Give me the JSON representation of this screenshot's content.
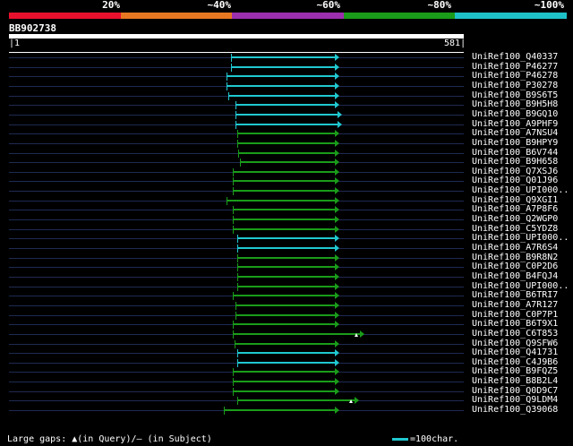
{
  "scale": {
    "segments": [
      {
        "label": "20%",
        "color": "#e8112d"
      },
      {
        "label": "~40%",
        "color": "#e87722"
      },
      {
        "label": "~60%",
        "color": "#9b2fae"
      },
      {
        "label": "~80%",
        "color": "#1a9c1a"
      },
      {
        "label": "~100%",
        "color": "#1ec1c8"
      }
    ]
  },
  "query": {
    "name": "BB902738",
    "start": "1",
    "end": "581"
  },
  "colors": {
    "cyan": "#20c8d0",
    "green": "#1a9c1a",
    "row": "#1f2a52"
  },
  "hits": [
    {
      "label": "UniRef100_Q40337",
      "color": "cyan",
      "gap": "none"
    },
    {
      "label": "UniRef100_P46277",
      "color": "cyan",
      "gap": "none"
    },
    {
      "label": "UniRef100_P46278",
      "color": "cyan",
      "gap": "none"
    },
    {
      "label": "UniRef100_P30278",
      "color": "cyan",
      "gap": "none"
    },
    {
      "label": "UniRef100_B9S6T5",
      "color": "cyan",
      "gap": "none"
    },
    {
      "label": "UniRef100_B9H5H8",
      "color": "cyan",
      "gap": "none"
    },
    {
      "label": "UniRef100_B9GQ10",
      "color": "cyan",
      "gap": "none"
    },
    {
      "label": "UniRef100_A9PHF9",
      "color": "cyan",
      "gap": "none"
    },
    {
      "label": "UniRef100_A7NSU4",
      "color": "green",
      "gap": "none"
    },
    {
      "label": "UniRef100_B9HPY9",
      "color": "green",
      "gap": "none"
    },
    {
      "label": "UniRef100_B6V744",
      "color": "green",
      "gap": "none"
    },
    {
      "label": "UniRef100_B9H658",
      "color": "green",
      "gap": "none"
    },
    {
      "label": "UniRef100_Q7XSJ6",
      "color": "green",
      "gap": "none"
    },
    {
      "label": "UniRef100_Q01J96",
      "color": "green",
      "gap": "none"
    },
    {
      "label": "UniRef100_UPI000..",
      "color": "green",
      "gap": "none"
    },
    {
      "label": "UniRef100_Q9XGI1",
      "color": "green",
      "gap": "none"
    },
    {
      "label": "UniRef100_A7P8F6",
      "color": "green",
      "gap": "none"
    },
    {
      "label": "UniRef100_Q2WGP0",
      "color": "green",
      "gap": "none"
    },
    {
      "label": "UniRef100_C5YDZ8",
      "color": "green",
      "gap": "none"
    },
    {
      "label": "UniRef100_UPI000..",
      "color": "cyan",
      "gap": "none"
    },
    {
      "label": "UniRef100_A7R6S4",
      "color": "cyan",
      "gap": "none"
    },
    {
      "label": "UniRef100_B9R8N2",
      "color": "green",
      "gap": "none"
    },
    {
      "label": "UniRef100_C0P2D6",
      "color": "green",
      "gap": "none"
    },
    {
      "label": "UniRef100_B4FQJ4",
      "color": "green",
      "gap": "none"
    },
    {
      "label": "UniRef100_UPI000..",
      "color": "green",
      "gap": "none"
    },
    {
      "label": "UniRef100_B6TRI7",
      "color": "green",
      "gap": "none"
    },
    {
      "label": "UniRef100_A7R127",
      "color": "green",
      "gap": "none"
    },
    {
      "label": "UniRef100_C0P7P1",
      "color": "green",
      "gap": "none"
    },
    {
      "label": "UniRef100_B6T9X1",
      "color": "green",
      "gap": "none"
    },
    {
      "label": "UniRef100_C6T853",
      "color": "green",
      "gap": "query"
    },
    {
      "label": "UniRef100_Q9SFW6",
      "color": "green",
      "gap": "none"
    },
    {
      "label": "UniRef100_Q41731",
      "color": "cyan",
      "gap": "none"
    },
    {
      "label": "UniRef100_C4J9B6",
      "color": "cyan",
      "gap": "none"
    },
    {
      "label": "UniRef100_B9FQZ5",
      "color": "green",
      "gap": "none"
    },
    {
      "label": "UniRef100_B8B2L4",
      "color": "green",
      "gap": "none"
    },
    {
      "label": "UniRef100_Q0D9C7",
      "color": "green",
      "gap": "none"
    },
    {
      "label": "UniRef100_Q9LDM4",
      "color": "green",
      "gap": "query"
    },
    {
      "label": "UniRef100_Q39068",
      "color": "green",
      "gap": "none"
    }
  ],
  "footer": {
    "text": "Large gaps: ▲(in Query)/— (in Subject)",
    "legend": "=100char."
  }
}
